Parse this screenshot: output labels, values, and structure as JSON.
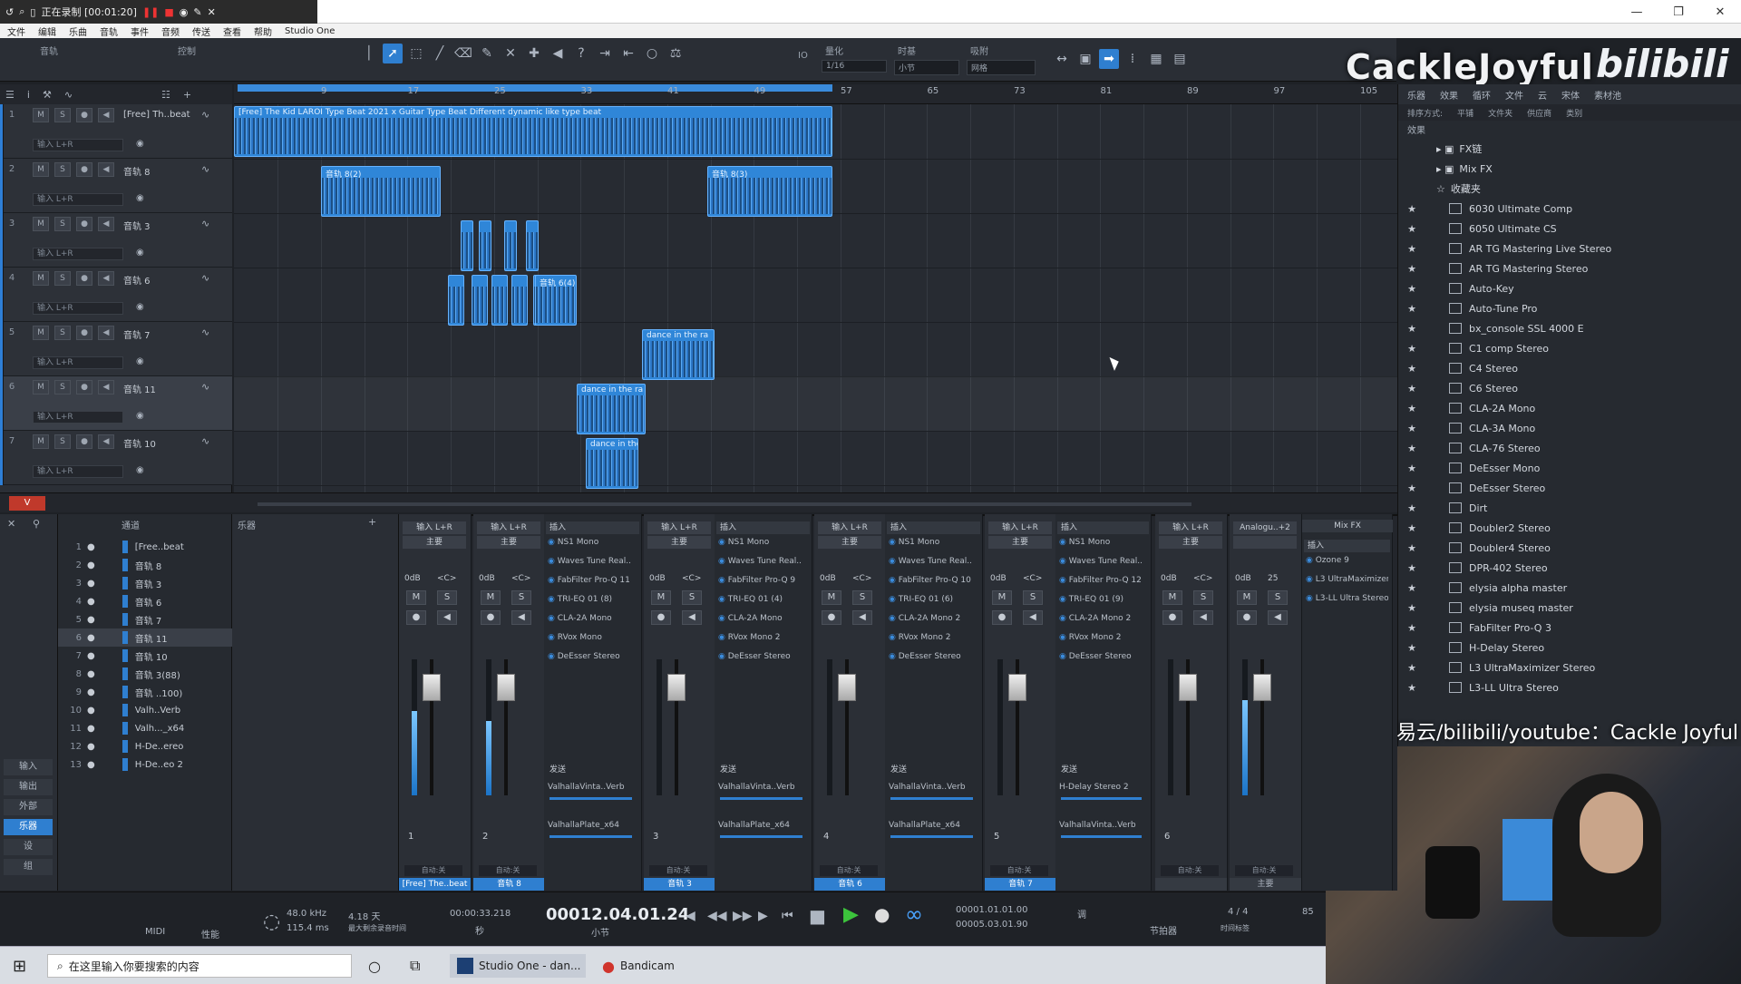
{
  "window": {
    "rec_status": "正在录制 [00:01:20]",
    "title": "Studio One"
  },
  "menu": [
    "文件",
    "编辑",
    "乐曲",
    "音轨",
    "事件",
    "音频",
    "传送",
    "查看",
    "帮助"
  ],
  "toolbar": {
    "quantize_label": "量化",
    "quantize_value": "1/16",
    "timebase_label": "时基",
    "timebase_value": "小节",
    "snap_label": "吸附",
    "snap_value": "网格",
    "io_label": "IO"
  },
  "watermark": {
    "name": "CackleJoyful",
    "logo": "bilibili",
    "bottom": "网易云/bilibili/youtube：Cackle Joyful"
  },
  "ruler": [
    "9",
    "17",
    "25",
    "33",
    "41",
    "49",
    "57",
    "65",
    "73",
    "81",
    "89",
    "97",
    "105"
  ],
  "tracks": [
    {
      "num": "1",
      "name": "[Free] Th..beat",
      "io": "输入 L+R"
    },
    {
      "num": "2",
      "name": "音轨 8",
      "io": "输入 L+R"
    },
    {
      "num": "3",
      "name": "音轨 3",
      "io": "输入 L+R"
    },
    {
      "num": "4",
      "name": "音轨 6",
      "io": "输入 L+R"
    },
    {
      "num": "5",
      "name": "音轨 7",
      "io": "输入 L+R"
    },
    {
      "num": "6",
      "name": "音轨 11",
      "io": "输入 L+R"
    },
    {
      "num": "7",
      "name": "音轨 10",
      "io": "输入 L+R"
    }
  ],
  "clips": {
    "beat": "[Free] The Kid LAROI Type Beat 2021 x Guitar Type Beat Different dynamic like type beat",
    "t2a": "音轨 8(2)",
    "t2b": "音轨 8(3)",
    "t4": "音轨 6(4)",
    "t5": "dance in the ra",
    "t6": "dance in the ra",
    "t7": "dance in the"
  },
  "browser": {
    "tabs": [
      "乐器",
      "效果",
      "循环",
      "文件",
      "云",
      "宋体",
      "素材池"
    ],
    "sub_tabs": [
      "排序方式:",
      "平铺",
      "文件夹",
      "供应商",
      "类别"
    ],
    "path": "效果",
    "items": [
      {
        "label": "FX链",
        "type": "folder",
        "star": false
      },
      {
        "label": "Mix FX",
        "type": "folder",
        "star": false
      },
      {
        "label": "收藏夹",
        "type": "fav",
        "star": false
      },
      {
        "label": "6030 Ultimate Comp",
        "type": "plugin",
        "star": true
      },
      {
        "label": "6050 Ultimate CS",
        "type": "plugin",
        "star": true
      },
      {
        "label": "AR TG Mastering Live Stereo",
        "type": "plugin",
        "star": true
      },
      {
        "label": "AR TG Mastering Stereo",
        "type": "plugin",
        "star": true
      },
      {
        "label": "Auto-Key",
        "type": "plugin",
        "star": true
      },
      {
        "label": "Auto-Tune Pro",
        "type": "plugin",
        "star": true
      },
      {
        "label": "bx_console SSL 4000 E",
        "type": "plugin",
        "star": true
      },
      {
        "label": "C1 comp Stereo",
        "type": "plugin",
        "star": true
      },
      {
        "label": "C4 Stereo",
        "type": "plugin",
        "star": true
      },
      {
        "label": "C6 Stereo",
        "type": "plugin",
        "star": true
      },
      {
        "label": "CLA-2A Mono",
        "type": "plugin",
        "star": true
      },
      {
        "label": "CLA-3A Mono",
        "type": "plugin",
        "star": true
      },
      {
        "label": "CLA-76 Stereo",
        "type": "plugin",
        "star": true
      },
      {
        "label": "DeEsser Mono",
        "type": "plugin",
        "star": true
      },
      {
        "label": "DeEsser Stereo",
        "type": "plugin",
        "star": true
      },
      {
        "label": "Dirt",
        "type": "plugin",
        "star": true
      },
      {
        "label": "Doubler2 Stereo",
        "type": "plugin",
        "star": true
      },
      {
        "label": "Doubler4 Stereo",
        "type": "plugin",
        "star": true
      },
      {
        "label": "DPR-402 Stereo",
        "type": "plugin",
        "star": true
      },
      {
        "label": "elysia alpha master",
        "type": "plugin",
        "star": true
      },
      {
        "label": "elysia museq master",
        "type": "plugin",
        "star": true
      },
      {
        "label": "FabFilter Pro-Q 3",
        "type": "plugin",
        "star": true
      },
      {
        "label": "H-Delay Stereo",
        "type": "plugin",
        "star": true
      },
      {
        "label": "L3 UltraMaximizer Stereo",
        "type": "plugin",
        "star": true
      },
      {
        "label": "L3-LL Ultra Stereo",
        "type": "plugin",
        "star": true
      }
    ]
  },
  "mixer_left": [
    "输入",
    "输出",
    "外部",
    "乐器",
    "设",
    "组"
  ],
  "chanlist": {
    "header": "通道",
    "rows": [
      {
        "n": "1",
        "name": "[Free..beat"
      },
      {
        "n": "2",
        "name": "音轨 8"
      },
      {
        "n": "3",
        "name": "音轨 3"
      },
      {
        "n": "4",
        "name": "音轨 6"
      },
      {
        "n": "5",
        "name": "音轨 7"
      },
      {
        "n": "6",
        "name": "音轨 11"
      },
      {
        "n": "7",
        "name": "音轨 10"
      },
      {
        "n": "8",
        "name": "音轨 3(88)"
      },
      {
        "n": "9",
        "name": "音轨 ..100)"
      },
      {
        "n": "10",
        "name": "Valh..Verb"
      },
      {
        "n": "11",
        "name": "Valh..._x64"
      },
      {
        "n": "12",
        "name": "H-De..ereo"
      },
      {
        "n": "13",
        "name": "H-De..eo 2"
      }
    ]
  },
  "instr_header": "乐器",
  "strips": [
    {
      "io": "输入 L+R",
      "out": "主要",
      "vol": "0dB",
      "pan": "<C>",
      "num": "1",
      "bottom": "[Free] The..beat",
      "blue": true,
      "level": 0.62
    },
    {
      "io": "输入 L+R",
      "out": "主要",
      "vol": "0dB",
      "pan": "<C>",
      "num": "2",
      "bottom": "音轨 8",
      "blue": true,
      "level": 0.55
    },
    {
      "io": "输入 L+R",
      "out": "主要",
      "vol": "0dB",
      "pan": "<C>",
      "num": "3",
      "bottom": "音轨 3",
      "blue": true,
      "level": 0.0
    },
    {
      "io": "输入 L+R",
      "out": "主要",
      "vol": "0dB",
      "pan": "<C>",
      "num": "4",
      "bottom": "音轨 6",
      "blue": true,
      "level": 0.0
    },
    {
      "io": "输入 L+R",
      "out": "主要",
      "vol": "0dB",
      "pan": "<C>",
      "num": "5",
      "bottom": "音轨 7",
      "blue": true,
      "level": 0.0
    },
    {
      "io": "输入 L+R",
      "out": "主要",
      "vol": "0dB",
      "pan": "<C>",
      "num": "6",
      "bottom": "",
      "blue": false,
      "level": 0.0
    },
    {
      "io": "Analogu..+2",
      "out": "",
      "vol": "0dB",
      "pan": "25",
      "num": "",
      "bottom": "主要",
      "blue": false,
      "level": 0.7
    }
  ],
  "inserts": [
    {
      "header": "插入",
      "plugins": [
        "NS1 Mono",
        "Waves Tune Real..",
        "FabFilter Pro-Q 11",
        "TRI-EQ 01 (8)",
        "CLA-2A Mono",
        "RVox Mono",
        "DeEsser Stereo"
      ],
      "sends": "发送",
      "send_items": [
        "ValhallaVinta..Verb",
        "ValhallaPlate_x64"
      ]
    },
    {
      "header": "插入",
      "plugins": [
        "NS1 Mono",
        "Waves Tune Real..",
        "FabFilter Pro-Q 9",
        "TRI-EQ 01 (4)",
        "CLA-2A Mono",
        "RVox Mono 2",
        "DeEsser Stereo"
      ],
      "sends": "发送",
      "send_items": [
        "ValhallaVinta..Verb",
        "ValhallaPlate_x64"
      ]
    },
    {
      "header": "插入",
      "plugins": [
        "NS1 Mono",
        "Waves Tune Real..",
        "FabFilter Pro-Q 10",
        "TRI-EQ 01 (6)",
        "CLA-2A Mono 2",
        "RVox Mono 2",
        "DeEsser Stereo"
      ],
      "sends": "发送",
      "send_items": [
        "ValhallaVinta..Verb",
        "ValhallaPlate_x64"
      ]
    },
    {
      "header": "插入",
      "plugins": [
        "NS1 Mono",
        "Waves Tune Real..",
        "FabFilter Pro-Q 12",
        "TRI-EQ 01 (9)",
        "CLA-2A Mono 2",
        "RVox Mono 2",
        "DeEsser Stereo"
      ],
      "sends": "发送",
      "send_items": [
        "H-Delay Stereo 2",
        "ValhallaVinta..Verb"
      ]
    },
    {
      "header": "插入",
      "plugins": [
        "Ozone 9",
        "L3 UltraMaximizer",
        "L3-LL Ultra Stereo"
      ],
      "sends": "",
      "send_items": []
    }
  ],
  "mixfx": "Mix FX",
  "auto_label": "自动:关",
  "transport": {
    "midi": "MIDI",
    "perf": "性能",
    "samplerate": "48.0 kHz",
    "latency": "115.4 ms",
    "record_time": "4.18 天",
    "record_time_label": "最大剩余录音时间",
    "seconds": "00:00:33.218",
    "seconds_label": "秒",
    "bars": "00012.04.01.24",
    "bars_label": "小节",
    "loop_l": "00001.01.01.00",
    "loop_r": "00005.03.01.90",
    "metronome": "节拍器",
    "timesig": "4 / 4",
    "timesig_label": "时间标签",
    "key": "调",
    "tempo": "85"
  },
  "taskbar": {
    "search": "在这里输入你要搜索的内容",
    "app1": "Studio One - dan...",
    "app2": "Bandicam"
  }
}
